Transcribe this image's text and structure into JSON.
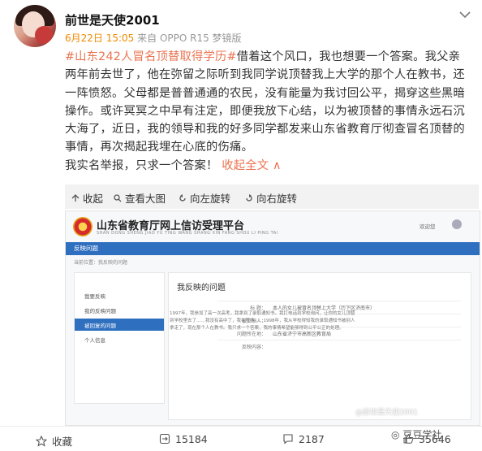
{
  "header": {
    "username": "前世是天使2001",
    "date": "6月22日 15:05",
    "source": "来自 OPPO R15 梦镜版",
    "more_icon": "chevron-down-icon"
  },
  "post": {
    "hashtag": "#山东242人冒名顶替取得学历#",
    "body": "借着这个风口，我也想要一个答案。我父亲两年前去世了，他在弥留之际听到我同学说顶替我上大学的那个人在教书，还一阵愤怒。父母都是普普通通的农民，没有能量为我讨回公平，揭穿这些黑暗操作。或许冥冥之中早有注定，即便我放下心结，以为被顶替的事情永远石沉大海了，近日，我的领导和我的好多同学都发来山东省教育厅彻查冒名顶替的事情，再次揭起我埋在心底的伤痛。",
    "last_line": "我实名举报，只求一个答案！",
    "expand_label": "收起全文 ∧"
  },
  "image_toolbar": {
    "collapse": "收起",
    "view_large": "查看大图",
    "rotate_left": "向左旋转",
    "rotate_right": "向右旋转"
  },
  "screenshot": {
    "portal_title": "山东省教育厅网上信访受理平台",
    "portal_subtitle": "SHAN DONG SHENG JIAO YU TING WANG SHANG XIN FANG SHOU LI PING TAI",
    "login_text": "欢迎您",
    "nav_label": "反映问题",
    "crumb": "当前位置：我反映的问题",
    "side_items": [
      "我要反映",
      "我的反映问题",
      "被回复的问题",
      "个人信息"
    ],
    "main_heading": "我反映的问题",
    "rows": [
      {
        "k": "标 题：",
        "v": "本人的女儿被冒名顶替上大学（历下区济南市）"
      },
      {
        "k": "被反映人：",
        "v": ""
      },
      {
        "k": "问题所在地：",
        "v": "山东省济宁市高新区教育局"
      },
      {
        "k": "反映内容：",
        "v": ""
      }
    ],
    "content_text": "1997年，我参加了高一次高考，我拿到了录取通知书。我打电话到学校询问，让你的女儿顶替到学校里去了……我没有高中了，我在等待……1998年，我从学校得知我的录取通知书被别人拿走了，现在那个人在教书。我只求一个答案，我的事情希望能够得到公平公正的处理。",
    "watermark": "@前世是天使2001"
  },
  "footer": {
    "favorite": "收藏",
    "repost": "15184",
    "comment": "2187",
    "like": "35646",
    "brand": "豆豆学社"
  }
}
